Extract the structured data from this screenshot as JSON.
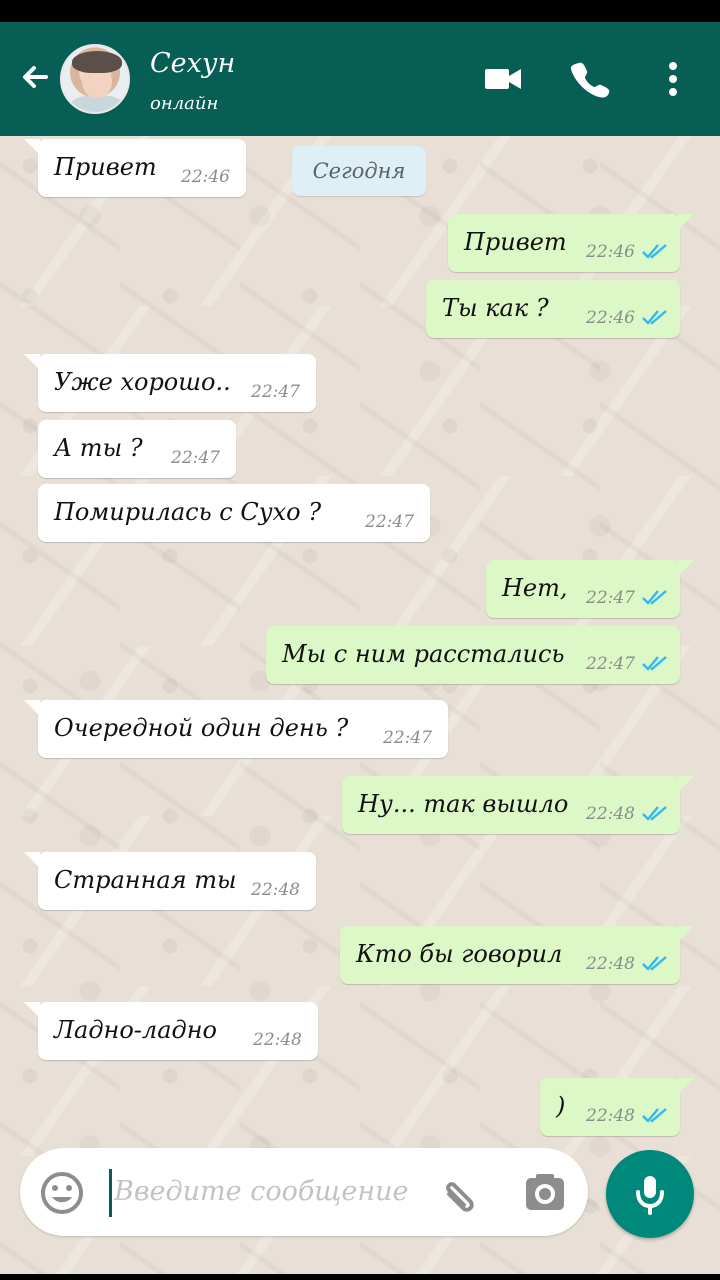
{
  "header": {
    "title": "Сехун",
    "status": "онлайн",
    "icons": {
      "back": "back-arrow-icon",
      "avatar": "contact-avatar",
      "video": "video-call-icon",
      "phone": "voice-call-icon",
      "more": "more-vertical-icon"
    }
  },
  "date_divider": "Сегодня",
  "messages": [
    {
      "direction": "incoming",
      "text": "Привет",
      "time": "22:46"
    },
    {
      "direction": "outgoing",
      "text": "Привет",
      "time": "22:46",
      "status_icon": "double-check-icon"
    },
    {
      "direction": "outgoing",
      "text": "Ты как ?",
      "time": "22:46",
      "status_icon": "double-check-icon"
    },
    {
      "direction": "incoming",
      "text": "Уже хорошо..",
      "time": "22:47"
    },
    {
      "direction": "incoming",
      "text": "А ты ?",
      "time": "22:47"
    },
    {
      "direction": "incoming",
      "text": "Помирилась с Сухо ?",
      "time": "22:47"
    },
    {
      "direction": "outgoing",
      "text": "Нет,",
      "time": "22:47",
      "status_icon": "double-check-icon"
    },
    {
      "direction": "outgoing",
      "text": "Мы с ним расстались",
      "time": "22:47",
      "status_icon": "double-check-icon"
    },
    {
      "direction": "incoming",
      "text": "Очередной один день ?",
      "time": "22:47"
    },
    {
      "direction": "outgoing",
      "text": "Ну... так вышло",
      "time": "22:48",
      "status_icon": "double-check-icon"
    },
    {
      "direction": "incoming",
      "text": "Странная ты",
      "time": "22:48"
    },
    {
      "direction": "outgoing",
      "text": "Кто бы говорил",
      "time": "22:48",
      "status_icon": "double-check-icon"
    },
    {
      "direction": "incoming",
      "text": "Ладно-ладно",
      "time": "22:48"
    },
    {
      "direction": "outgoing",
      "text": ")",
      "time": "22:48",
      "status_icon": "double-check-icon"
    }
  ],
  "composer": {
    "placeholder": "Введите сообщение",
    "icons": {
      "emoji": "emoji-icon",
      "attach": "paperclip-icon",
      "camera": "camera-icon",
      "mic": "microphone-icon"
    }
  },
  "colors": {
    "header": "#075e54",
    "incoming_bubble": "#ffffff",
    "outgoing_bubble": "#dcf8c6",
    "accent": "#00897b",
    "read_check": "#34b7f1"
  }
}
